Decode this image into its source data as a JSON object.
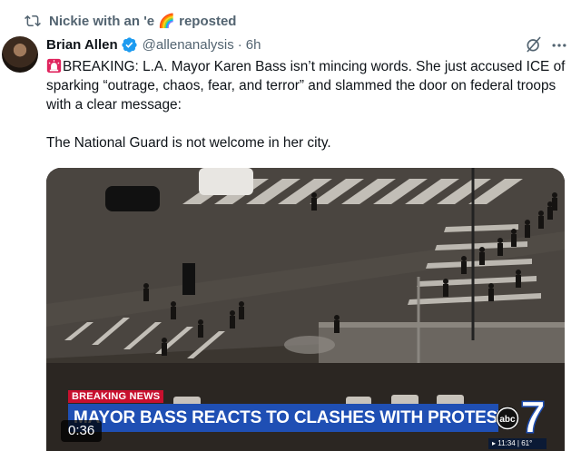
{
  "repost": {
    "text": "Nickie with an 'e 🌈 reposted",
    "icon": "repost-icon"
  },
  "author": {
    "display_name": "Brian Allen",
    "verified_icon": "verified-badge-icon",
    "handle": "@allenanalysis",
    "separator": "·",
    "time": "6h",
    "avatar_icon": "avatar"
  },
  "actions": {
    "grok_icon": "grok-icon",
    "more_icon": "more-icon"
  },
  "tweet": {
    "siren_icon": "siren-emoji-icon",
    "text": "BREAKING: L.A. Mayor Karen Bass isn’t mincing words. She just accused ICE of sparking “outrage, chaos, fear, and terror” and slammed the door on federal troops with a clear message:\n\nThe National Guard is not welcome in her city."
  },
  "video": {
    "breaking_tag": "BREAKING NEWS",
    "headline": "MAYOR BASS REACTS TO CLASHES WITH PROTESTERS",
    "logo": "abc7-logo",
    "logo_text": "abc",
    "logo_number": "7",
    "clock": "▸ 11:34 | 61°",
    "duration": "0:36"
  },
  "colors": {
    "text": "#0f1419",
    "secondary": "#536471",
    "verified": "#1d9bf0",
    "headline_bar": "#1f4fb4",
    "breaking_red": "#c8102e"
  }
}
